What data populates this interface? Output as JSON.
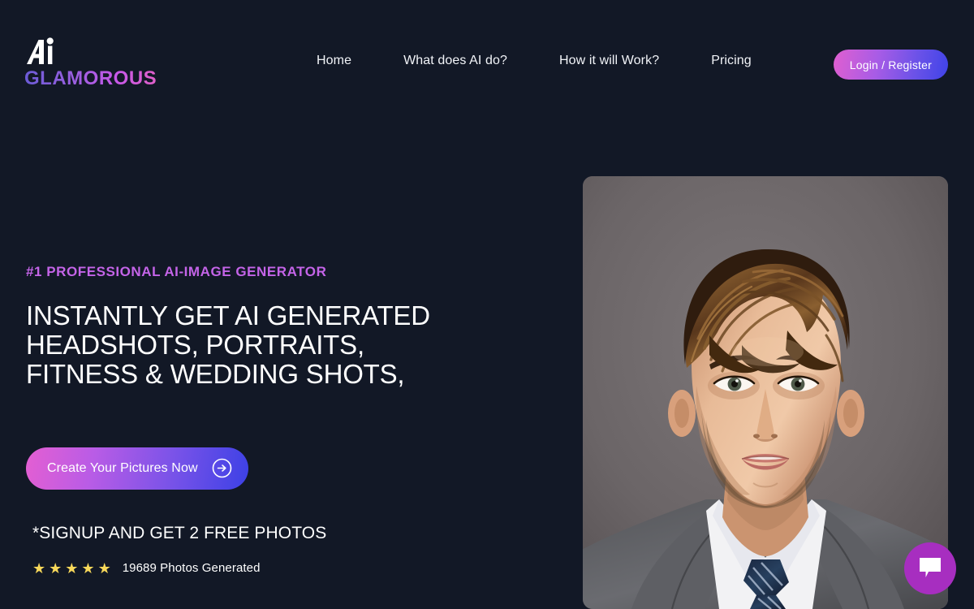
{
  "brand": {
    "mark_icon": "ai-monogram-icon",
    "word": "GLAMOROUS"
  },
  "nav": {
    "items": [
      {
        "label": "Home"
      },
      {
        "label": "What does AI do?"
      },
      {
        "label": "How it will Work?"
      },
      {
        "label": "Pricing"
      }
    ]
  },
  "auth": {
    "label": "Login / Register"
  },
  "hero": {
    "eyebrow": "#1 PROFESSIONAL AI-IMAGE GENERATOR",
    "headline": "INSTANTLY GET AI GENERATED HEADSHOTS, PORTRAITS, FITNESS & WEDDING SHOTS,",
    "cta_label": "Create Your Pictures Now",
    "cta_icon": "arrow-right-circle-icon",
    "signup_note": "*SIGNUP AND GET 2 FREE PHOTOS",
    "stars": [
      "★",
      "★",
      "★",
      "★",
      "★"
    ],
    "rating_text": "19689 Photos Generated",
    "image_alt": "ai-generated-headshot-man-in-suit"
  },
  "chat": {
    "icon": "chat-bubble-icon"
  },
  "colors": {
    "page_background": "#121826",
    "accent_purple": "#c464e8",
    "gradient_start": "#e45fd2",
    "gradient_end": "#3c41e6",
    "star_yellow": "#f8d85a",
    "chat_purple": "#a72ec0"
  }
}
